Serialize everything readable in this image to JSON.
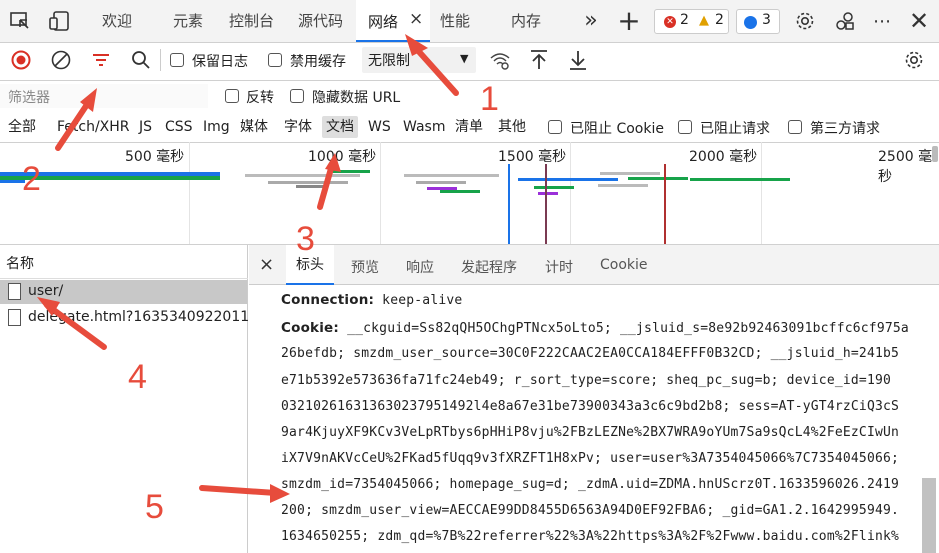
{
  "tabs": [
    {
      "label": "欢迎"
    },
    {
      "label": "元素"
    },
    {
      "label": "控制台"
    },
    {
      "label": "源代码"
    },
    {
      "label": "网络",
      "active": true
    },
    {
      "label": "性能"
    },
    {
      "label": "内存"
    }
  ],
  "tab_close": "×",
  "more_tabs": "»",
  "add_tab": "+",
  "badges": {
    "errors": "2",
    "warnings": "2",
    "messages": "3"
  },
  "toolbar": {
    "preserve_log": "保留日志",
    "disable_cache": "禁用缓存",
    "throttle": "无限制"
  },
  "filter": {
    "placeholder": "筛选器",
    "invert": "反转",
    "hide_data_urls": "隐藏数据 URL"
  },
  "types": [
    "全部",
    "Fetch/XHR",
    "JS",
    "CSS",
    "Img",
    "媒体",
    "字体",
    "文档",
    "WS",
    "Wasm",
    "清单",
    "其他"
  ],
  "type_active": "文档",
  "type_checks": {
    "blocked_cookie": "已阻止 Cookie",
    "blocked_request": "已阻止请求",
    "third_party": "第三方请求"
  },
  "timeline": {
    "ticks": [
      "500 毫秒",
      "1000 毫秒",
      "1500 毫秒",
      "2000 毫秒",
      "2500 毫秒"
    ]
  },
  "requests": {
    "header": "名称",
    "items": [
      "user/",
      "delegate.html?1635340922011"
    ]
  },
  "detail_tabs": [
    "标头",
    "预览",
    "响应",
    "发起程序",
    "计时",
    "Cookie"
  ],
  "detail_close": "×",
  "headers": {
    "connection_key": "Connection:",
    "connection_val": "keep-alive",
    "cookie_key": "Cookie:",
    "cookie_lines": [
      "__ckguid=Ss82qQH5OChgPTNcx5oLto5; __jsluid_s=8e92b92463091bcffc6cf975a",
      "26befdb; smzdm_user_source=30C0F222CAAC2EA0CCA184EFFF0B32CD; __jsluid_h=241b5",
      "e71b5392e573636fa71fc24eb49; r_sort_type=score; sheq_pc_sug=b; device_id=190",
      "032102616313630237951492l4e8a67e31be73900343a3c6c9bd2b8; sess=AT-yGT4rzCiQ3cS",
      "9ar4KjuyXF9KCv3VeLpRTbys6pHHiP8vju%2FBzLEZNe%2BX7WRA9oYUm7Sa9sQcL4%2FeEzCIwUn",
      "iX7V9nAKVcCeU%2FKad5fUqq9v3fXRZFT1H8xPv; user=user%3A7354045066%7C7354045066;",
      "smzdm_id=7354045066; homepage_sug=d; _zdmA.uid=ZDMA.hnUScrz0T.1633596026.2419",
      "200; smzdm_user_view=AECCAE99DD8455D6563A94D0EF92FBA6; _gid=GA1.2.1642995949.",
      "1634650255; zdm_qd=%7B%22referrer%22%3A%22https%3A%2F%2Fwww.baidu.com%2Flink%"
    ]
  },
  "annotations": [
    "1",
    "2",
    "3",
    "4",
    "5"
  ],
  "colors": {
    "annotation": "#e74c3c",
    "accent": "#1a73e8",
    "active_tab_bg": "#ffffff"
  }
}
